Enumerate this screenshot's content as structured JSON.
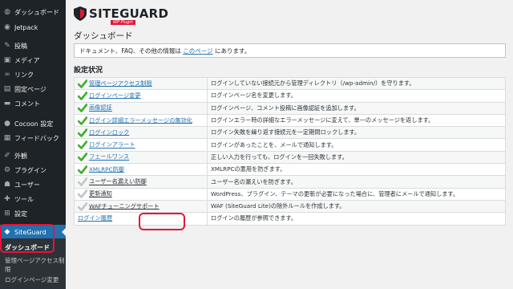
{
  "sidebar": {
    "items": [
      {
        "label": "ダッシュボード",
        "icon": "dashboard-icon",
        "glyph": "◍"
      },
      {
        "label": "Jetpack",
        "icon": "jetpack-icon",
        "glyph": "◉"
      },
      {
        "label": "投稿",
        "icon": "pin-icon",
        "glyph": "✎"
      },
      {
        "label": "メディア",
        "icon": "media-icon",
        "glyph": "▣"
      },
      {
        "label": "リンク",
        "icon": "link-icon",
        "glyph": "∞"
      },
      {
        "label": "固定ページ",
        "icon": "page-icon",
        "glyph": "▤"
      },
      {
        "label": "コメント",
        "icon": "comment-icon",
        "glyph": "▬"
      },
      {
        "label": "Cocoon 設定",
        "icon": "cocoon-icon",
        "glyph": "●"
      },
      {
        "label": "フィードバック",
        "icon": "feedback-icon",
        "glyph": "▦"
      },
      {
        "label": "外観",
        "icon": "appearance-icon",
        "glyph": "✐"
      },
      {
        "label": "プラグイン",
        "icon": "plugin-icon",
        "glyph": "⚙"
      },
      {
        "label": "ユーザー",
        "icon": "user-icon",
        "glyph": "☗"
      },
      {
        "label": "ツール",
        "icon": "tool-icon",
        "glyph": "✚"
      },
      {
        "label": "設定",
        "icon": "settings-icon",
        "glyph": "⊞"
      }
    ],
    "active": {
      "label": "SiteGuard",
      "icon": "siteguard-icon",
      "glyph": "◆"
    },
    "submenu": [
      "ダッシュボード",
      "管理ページアクセス制",
      "限",
      "ログインページ変更"
    ]
  },
  "main": {
    "logo": {
      "text": "SITEGUARD",
      "sub": "WP Plugin"
    },
    "title": "ダッシュボード",
    "info": {
      "before": "ドキュメント、FAQ、その他の情報は ",
      "link": "このページ",
      "after": " にあります。"
    },
    "section_title": "設定状況",
    "colors": {
      "accent": "#2271b1",
      "check": "#3dae2b",
      "check_off": "#c3c4c7",
      "highlight": "#e2163a"
    },
    "rows": [
      {
        "name": "管理ページアクセス制限",
        "desc": "ログインしていない接続元から管理ディレクトリ（/wp-admin/）を守ります。",
        "enabled": true
      },
      {
        "name": "ログインページ変更",
        "desc": "ログインページ名を変更します。",
        "enabled": true
      },
      {
        "name": "画像認証",
        "desc": "ログインページ、コメント投稿に画像認証を追加します。",
        "enabled": true
      },
      {
        "name": "ログイン詳細エラーメッセージの無効化",
        "desc": "ログインエラー時の詳細なエラーメッセージに変えて、単一のメッセージを返します。",
        "enabled": true
      },
      {
        "name": "ログインロック",
        "desc": "ログイン失敗を繰り返す接続元を一定期間ロックします。",
        "enabled": true
      },
      {
        "name": "ログインアラート",
        "desc": "ログインがあったことを、メールで通知します。",
        "enabled": true
      },
      {
        "name": "フェールワンス",
        "desc": "正しい入力を行っても、ログインを一回失敗します。",
        "enabled": true
      },
      {
        "name": "XMLRPC防御",
        "desc": "XMLRPCの悪用を防ぎます。",
        "enabled": true
      },
      {
        "name": "ユーザー名漏えい防御",
        "desc": "ユーザー名の漏えいを防ぎます。",
        "enabled": false
      },
      {
        "name": "更新通知",
        "desc": "WordPress、プラグイン、テーマの更新が必要になった場合に、管理者にメールで通知します。",
        "enabled": false
      },
      {
        "name": "WAFチューニングサポート",
        "desc": "WAF (SiteGuard Lite)の除外ルールを作成します。",
        "enabled": false
      },
      {
        "name": "ログイン履歴",
        "desc": "ログインの履歴が参照できます。",
        "enabled": null
      }
    ]
  }
}
